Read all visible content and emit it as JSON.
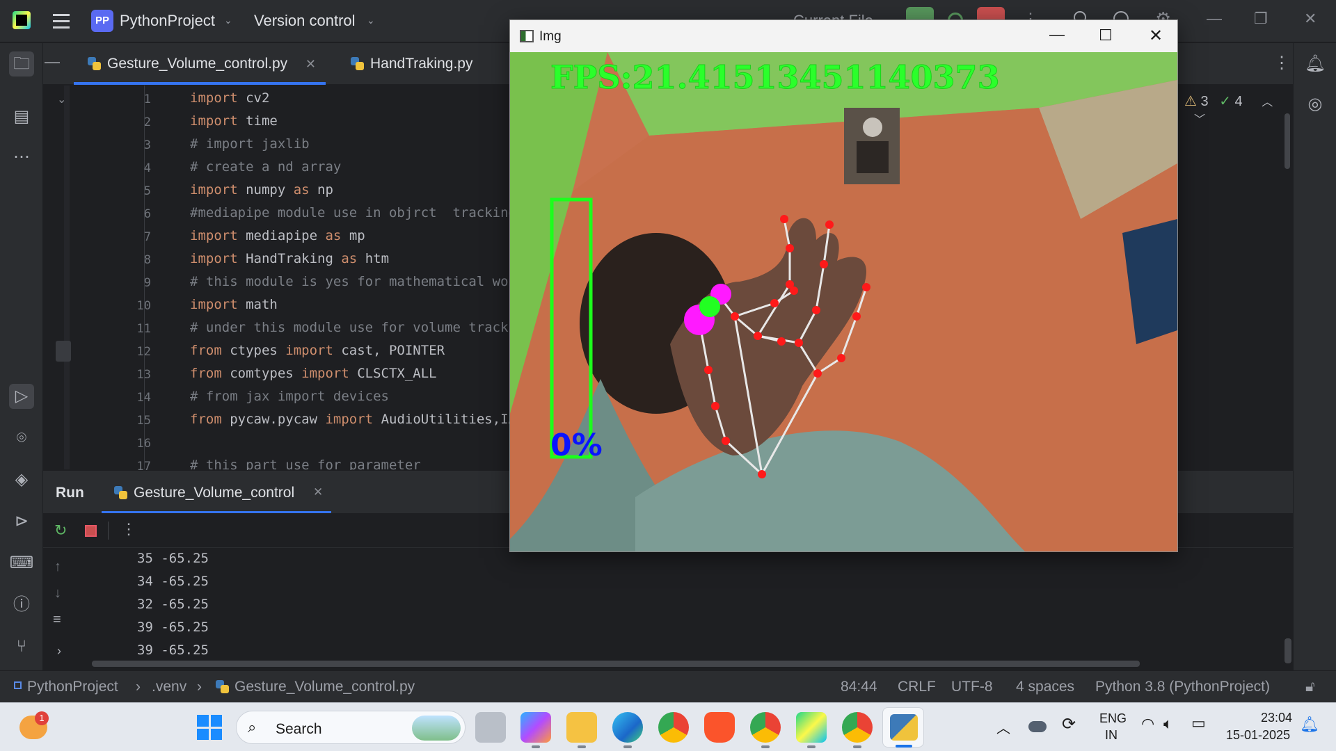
{
  "titlebar": {
    "project_badge": "PP",
    "project_name": "PythonProject",
    "vcs": "Version control",
    "run_config_partial": "Current File"
  },
  "tabs": [
    {
      "label": "Gesture_Volume_control.py",
      "active": true
    },
    {
      "label": "HandTraking.py",
      "active": false
    }
  ],
  "inspections": {
    "warnings": "3",
    "ok": "4"
  },
  "editor": {
    "line_numbers": [
      "1",
      "2",
      "3",
      "4",
      "5",
      "6",
      "7",
      "8",
      "9",
      "10",
      "11",
      "12",
      "13",
      "14",
      "15",
      "16",
      "17"
    ],
    "lines": [
      [
        {
          "t": "import",
          "c": "kw"
        },
        {
          "t": " cv2"
        }
      ],
      [
        {
          "t": "import",
          "c": "kw"
        },
        {
          "t": " time"
        }
      ],
      [
        {
          "t": "# import jaxlib",
          "c": "cm"
        }
      ],
      [
        {
          "t": "# create a nd array",
          "c": "cm"
        }
      ],
      [
        {
          "t": "import",
          "c": "kw"
        },
        {
          "t": " numpy "
        },
        {
          "t": "as",
          "c": "kw"
        },
        {
          "t": " np"
        }
      ],
      [
        {
          "t": "#mediapipe module use in objrct  tracking in",
          "c": "cm"
        }
      ],
      [
        {
          "t": "import",
          "c": "kw"
        },
        {
          "t": " mediapipe "
        },
        {
          "t": "as",
          "c": "kw"
        },
        {
          "t": " mp"
        }
      ],
      [
        {
          "t": "import",
          "c": "kw"
        },
        {
          "t": " HandTraking "
        },
        {
          "t": "as",
          "c": "kw"
        },
        {
          "t": " htm"
        }
      ],
      [
        {
          "t": "# this module is yes for mathematical work",
          "c": "cm"
        }
      ],
      [
        {
          "t": "import",
          "c": "kw"
        },
        {
          "t": " math"
        }
      ],
      [
        {
          "t": "# under this module use for volume tracking,",
          "c": "cm"
        }
      ],
      [
        {
          "t": "from",
          "c": "kw"
        },
        {
          "t": " ctypes "
        },
        {
          "t": "import",
          "c": "kw"
        },
        {
          "t": " cast, POINTER"
        }
      ],
      [
        {
          "t": "from",
          "c": "kw"
        },
        {
          "t": " comtypes "
        },
        {
          "t": "import",
          "c": "kw"
        },
        {
          "t": " CLSCTX_ALL"
        }
      ],
      [
        {
          "t": "# from jax import devices",
          "c": "cm"
        }
      ],
      [
        {
          "t": "from",
          "c": "kw"
        },
        {
          "t": " pycaw.pycaw "
        },
        {
          "t": "import",
          "c": "kw"
        },
        {
          "t": " AudioUtilities,IAudi"
        }
      ],
      [],
      [
        {
          "t": "# this part use for parameter",
          "c": "cm"
        }
      ]
    ]
  },
  "run": {
    "tab_label": "Run",
    "config_label": "Gesture_Volume_control",
    "output": [
      "35 -65.25",
      "34 -65.25",
      "32 -65.25",
      "39 -65.25",
      "39 -65.25"
    ]
  },
  "statusbar": {
    "breadcrumb": [
      "PythonProject",
      ".venv",
      "Gesture_Volume_control.py"
    ],
    "position": "84:44",
    "line_sep": "CRLF",
    "encoding": "UTF-8",
    "indent": "4 spaces",
    "interpreter": "Python 3.8 (PythonProject)"
  },
  "img_window": {
    "title": "Img",
    "fps_text": "FPS:21.41513451140373",
    "volume_percent_text": "0%",
    "volume_level": 0
  },
  "taskbar": {
    "search_placeholder": "Search",
    "lang_top": "ENG",
    "lang_bottom": "IN",
    "time": "23:04",
    "date": "15-01-2025",
    "weather_badge": "1"
  },
  "colors": {
    "accent": "#3574f0",
    "keyword": "#cf8e6d",
    "comment": "#7a7e85",
    "fps_green": "#2bff2b",
    "landmark_red": "#ff1a1a",
    "landmark_magenta": "#ff1aff",
    "percent_blue": "#0a14ff"
  }
}
